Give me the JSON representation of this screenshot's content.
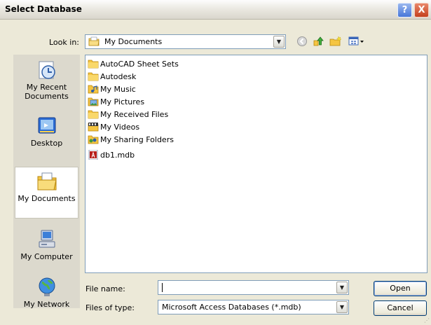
{
  "window": {
    "title": "Select Database",
    "help_symbol": "?",
    "close_symbol": "X"
  },
  "lookin": {
    "label": "Look in:",
    "value": "My Documents"
  },
  "toolbar": {
    "back_icon": "back-icon",
    "up_icon": "up-folder-icon",
    "new_folder_icon": "new-folder-icon",
    "views_icon": "views-menu-icon"
  },
  "places": [
    {
      "label": "My Recent\nDocuments",
      "icon": "recent-documents-icon"
    },
    {
      "label": "Desktop",
      "icon": "desktop-icon"
    },
    {
      "label": "My Documents",
      "icon": "my-documents-icon",
      "selected": true
    },
    {
      "label": "My Computer",
      "icon": "my-computer-icon"
    },
    {
      "label": "My Network",
      "icon": "my-network-icon"
    }
  ],
  "files": [
    {
      "name": "AutoCAD Sheet Sets",
      "icon": "folder-icon"
    },
    {
      "name": "Autodesk",
      "icon": "folder-icon"
    },
    {
      "name": "My Music",
      "icon": "music-folder-icon"
    },
    {
      "name": "My Pictures",
      "icon": "pictures-folder-icon"
    },
    {
      "name": "My Received Files",
      "icon": "folder-icon"
    },
    {
      "name": "My Videos",
      "icon": "videos-folder-icon"
    },
    {
      "name": "My Sharing Folders",
      "icon": "shared-folder-icon"
    },
    {
      "name": "db1.mdb",
      "icon": "access-database-icon"
    }
  ],
  "filename": {
    "label": "File name:",
    "value": ""
  },
  "filetype": {
    "label": "Files of type:",
    "value": "Microsoft Access Databases  (*.mdb)"
  },
  "buttons": {
    "open": "Open",
    "cancel": "Cancel"
  }
}
